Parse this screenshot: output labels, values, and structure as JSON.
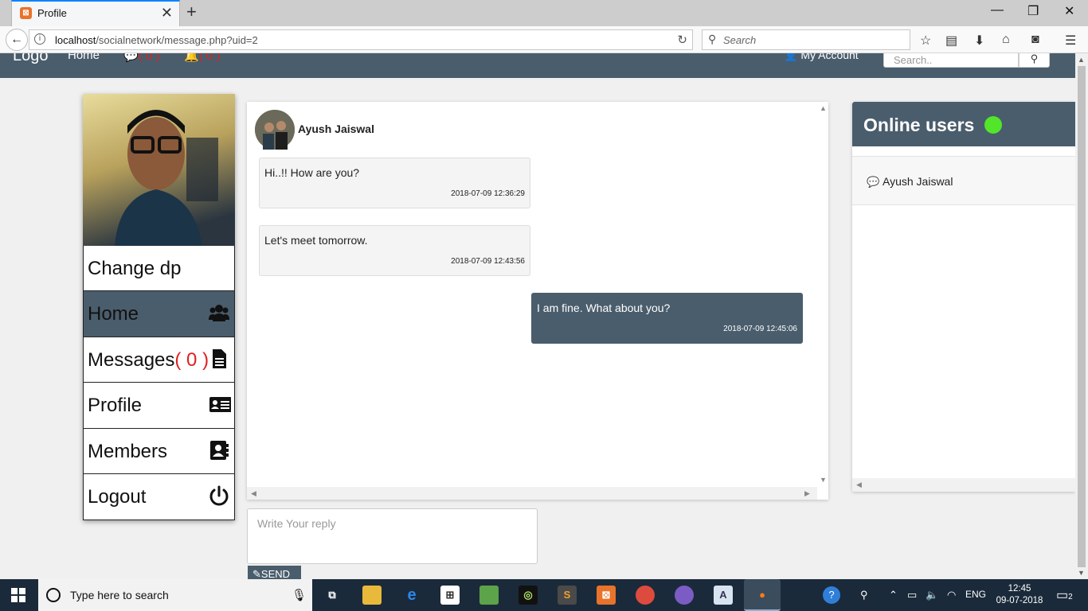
{
  "browser": {
    "tab_title": "Profile",
    "tab_favicon": "xampp-icon",
    "url_host": "localhost",
    "url_path": "/socialnetwork/message.php?uid=2",
    "search_placeholder": "Search"
  },
  "site_nav": {
    "logo": "Logo",
    "home": "Home",
    "messages_count": "( 0 )",
    "notifications_count": "( 0 )",
    "account": "My Account",
    "search_placeholder": "Search.."
  },
  "sidebar": {
    "change_dp": "Change dp",
    "items": [
      {
        "label": "Home",
        "icon": "users-icon"
      },
      {
        "label": "Messages",
        "count": "( 0 )",
        "icon": "document-icon"
      },
      {
        "label": "Profile",
        "icon": "id-card-icon"
      },
      {
        "label": "Members",
        "icon": "address-book-icon"
      },
      {
        "label": "Logout",
        "icon": "power-icon"
      }
    ]
  },
  "chat": {
    "contact_name": "Ayush Jaiswal",
    "messages": [
      {
        "text": "Hi..!! How are you?",
        "time": "2018-07-09 12:36:29",
        "mine": false
      },
      {
        "text": "Let's meet tomorrow.",
        "time": "2018-07-09 12:43:56",
        "mine": false
      },
      {
        "text": "I am fine. What about you?",
        "time": "2018-07-09 12:45:06",
        "mine": true
      }
    ],
    "reply_placeholder": "Write Your reply",
    "send_label": "SEND"
  },
  "online_users": {
    "title": "Online users",
    "status_color": "#52e52a",
    "users": [
      "Ayush Jaiswal"
    ]
  },
  "taskbar": {
    "search_text": "Type here to search",
    "language": "ENG",
    "time": "12:45",
    "date": "09-07-2018",
    "notification_count": "2"
  },
  "colors": {
    "accent": "#4a5d6c",
    "alert": "#e02020"
  }
}
